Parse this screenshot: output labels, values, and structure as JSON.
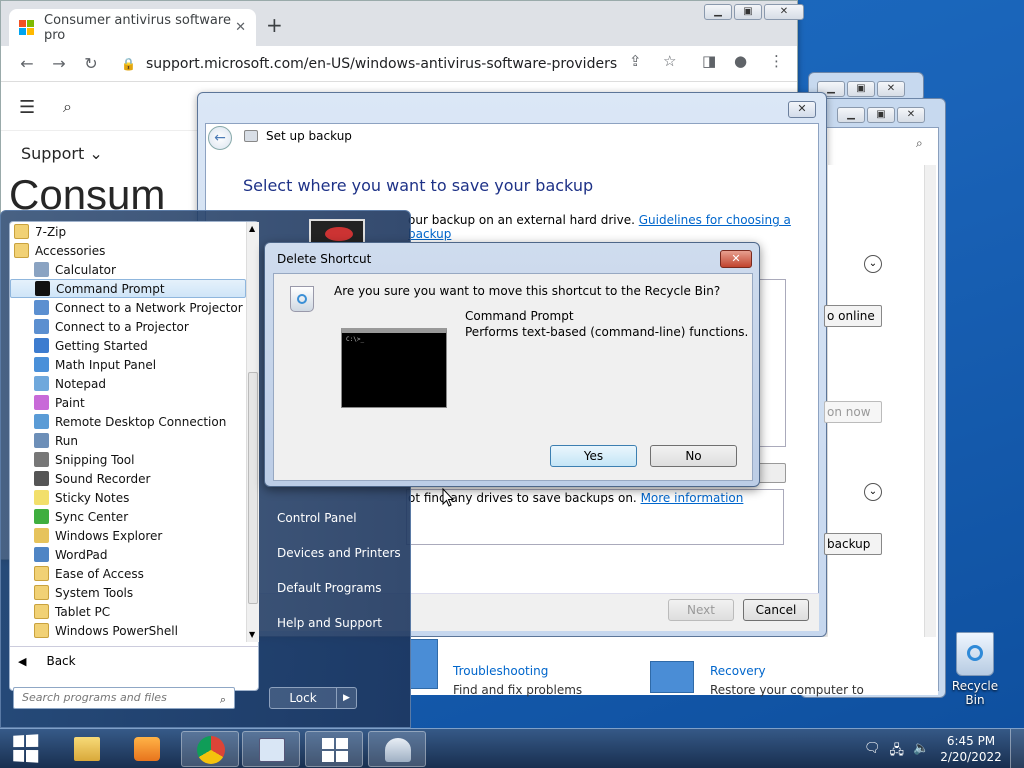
{
  "browser": {
    "tab_title": "Consumer antivirus software pro",
    "url": "support.microsoft.com/en-US/windows-antivirus-software-providers",
    "nav_label": "Support",
    "page_heading": "Consum"
  },
  "wizard": {
    "title": "Set up backup",
    "heading": "Select where you want to save your backup",
    "description": "our backup on an external hard drive.",
    "description_link": "Guidelines for choosing a backup",
    "drives_message": "ot find any drives to save backups on.",
    "drives_link": "More information",
    "next_label": "Next",
    "cancel_label": "Cancel"
  },
  "control_panel": {
    "fragments": [
      "o online",
      "on now",
      "backup"
    ],
    "troubleshooting_title": "Troubleshooting",
    "troubleshooting_desc": "Find and fix problems",
    "recovery_title": "Recovery",
    "recovery_desc": "Restore your computer to"
  },
  "start_menu": {
    "programs": [
      {
        "label": "7-Zip",
        "icon": "folder-icon",
        "level": 0
      },
      {
        "label": "Accessories",
        "icon": "folder-icon",
        "level": 0
      },
      {
        "label": "Calculator",
        "icon": "calculator-icon",
        "level": 1
      },
      {
        "label": "Command Prompt",
        "icon": "command-prompt-icon",
        "level": 1,
        "selected": true
      },
      {
        "label": "Connect to a Network Projector",
        "icon": "network-projector-icon",
        "level": 1
      },
      {
        "label": "Connect to a Projector",
        "icon": "projector-icon",
        "level": 1
      },
      {
        "label": "Getting Started",
        "icon": "getting-started-icon",
        "level": 1
      },
      {
        "label": "Math Input Panel",
        "icon": "math-input-icon",
        "level": 1
      },
      {
        "label": "Notepad",
        "icon": "notepad-icon",
        "level": 1
      },
      {
        "label": "Paint",
        "icon": "paint-icon",
        "level": 1
      },
      {
        "label": "Remote Desktop Connection",
        "icon": "remote-desktop-icon",
        "level": 1
      },
      {
        "label": "Run",
        "icon": "run-icon",
        "level": 1
      },
      {
        "label": "Snipping Tool",
        "icon": "snipping-tool-icon",
        "level": 1
      },
      {
        "label": "Sound Recorder",
        "icon": "sound-recorder-icon",
        "level": 1
      },
      {
        "label": "Sticky Notes",
        "icon": "sticky-notes-icon",
        "level": 1
      },
      {
        "label": "Sync Center",
        "icon": "sync-center-icon",
        "level": 1
      },
      {
        "label": "Windows Explorer",
        "icon": "windows-explorer-icon",
        "level": 1
      },
      {
        "label": "WordPad",
        "icon": "wordpad-icon",
        "level": 1
      },
      {
        "label": "Ease of Access",
        "icon": "folder-icon",
        "level": 1
      },
      {
        "label": "System Tools",
        "icon": "folder-icon",
        "level": 1
      },
      {
        "label": "Tablet PC",
        "icon": "folder-icon",
        "level": 1
      },
      {
        "label": "Windows PowerShell",
        "icon": "folder-icon",
        "level": 1
      }
    ],
    "back_label": "Back",
    "search_placeholder": "Search programs and files",
    "right_items": [
      "Control Panel",
      "Devices and Printers",
      "Default Programs",
      "Help and Support"
    ],
    "lock_label": "Lock"
  },
  "dialog": {
    "title": "Delete Shortcut",
    "question": "Are you sure you want to move this shortcut to the Recycle Bin?",
    "item_name": "Command Prompt",
    "item_desc": "Performs text-based (command-line) functions.",
    "thumb_text": "C:\\>_",
    "yes_label": "Yes",
    "no_label": "No"
  },
  "desktop": {
    "recycle_bin_label": "Recycle Bin"
  },
  "taskbar": {
    "apps": [
      "file-explorer-icon",
      "media-player-icon",
      "chrome-icon",
      "control-panel-icon",
      "windows-icon",
      "backup-icon"
    ],
    "time": "6:45 PM",
    "date": "2/20/2022"
  },
  "colors": {
    "accent_link": "#0066cc",
    "wizard_heading": "#1e3287",
    "selection": "#cfe5f8"
  }
}
